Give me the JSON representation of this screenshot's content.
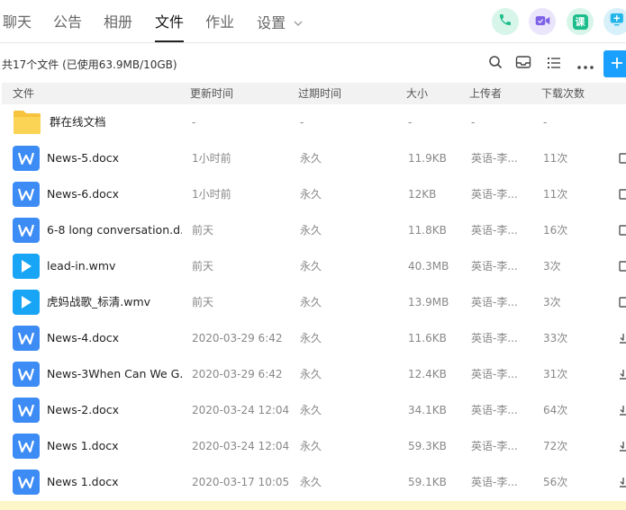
{
  "nav": {
    "tabs": [
      {
        "label": "聊天",
        "active": false
      },
      {
        "label": "公告",
        "active": false
      },
      {
        "label": "相册",
        "active": false
      },
      {
        "label": "文件",
        "active": true
      },
      {
        "label": "作业",
        "active": false
      },
      {
        "label": "设置",
        "active": false
      }
    ],
    "quick_actions": [
      {
        "icon": "phone-icon",
        "color": "#1bbd8b",
        "bg": "#d8f5ea"
      },
      {
        "icon": "video-camera-icon",
        "color": "#7e62e6",
        "bg": "#ebe5fb"
      },
      {
        "icon": "class-icon",
        "label": "课",
        "color": "#1bbd8b",
        "bg": "#d8f5ea"
      },
      {
        "icon": "share-screen-icon",
        "color": "#22b6e8",
        "bg": "#d7f0fa"
      }
    ]
  },
  "summary": {
    "text": "共17个文件 (已使用63.9MB/10GB)"
  },
  "toolbar": {
    "icons": [
      "search-icon",
      "inbox-icon",
      "list-view-icon",
      "more-icon",
      "plus-icon"
    ]
  },
  "table": {
    "columns": [
      "文件",
      "更新时间",
      "过期时间",
      "大小",
      "上传者",
      "下载次数"
    ],
    "rows": [
      {
        "type": "folder",
        "name": "群在线文档",
        "updated": "-",
        "expires": "-",
        "size": "-",
        "uploader": "-",
        "downloads": "-"
      },
      {
        "type": "word",
        "name": "News-5.docx",
        "updated": "1小时前",
        "expires": "永久",
        "size": "11.9KB",
        "uploader": "英语-李...",
        "downloads": "11次"
      },
      {
        "type": "word",
        "name": "News-6.docx",
        "updated": "1小时前",
        "expires": "永久",
        "size": "12KB",
        "uploader": "英语-李...",
        "downloads": "11次"
      },
      {
        "type": "word",
        "name": "6-8 long conversation.d...",
        "updated": "前天",
        "expires": "永久",
        "size": "11.8KB",
        "uploader": "英语-李...",
        "downloads": "16次"
      },
      {
        "type": "video",
        "name": "lead-in.wmv",
        "updated": "前天",
        "expires": "永久",
        "size": "40.3MB",
        "uploader": "英语-李...",
        "downloads": "3次"
      },
      {
        "type": "video",
        "name": "虎妈战歌_标清.wmv",
        "updated": "前天",
        "expires": "永久",
        "size": "13.9MB",
        "uploader": "英语-李...",
        "downloads": "3次"
      },
      {
        "type": "word",
        "name": "News-4.docx",
        "updated": "2020-03-29 6:42",
        "expires": "永久",
        "size": "11.6KB",
        "uploader": "英语-李...",
        "downloads": "33次"
      },
      {
        "type": "word",
        "name": "News-3When Can We G...",
        "updated": "2020-03-29 6:42",
        "expires": "永久",
        "size": "12.4KB",
        "uploader": "英语-李...",
        "downloads": "31次"
      },
      {
        "type": "word",
        "name": "News-2.docx",
        "updated": "2020-03-24 12:04",
        "expires": "永久",
        "size": "34.1KB",
        "uploader": "英语-李...",
        "downloads": "64次"
      },
      {
        "type": "word",
        "name": "News 1.docx",
        "updated": "2020-03-24 12:04",
        "expires": "永久",
        "size": "59.3KB",
        "uploader": "英语-李...",
        "downloads": "72次"
      },
      {
        "type": "word",
        "name": "News 1.docx",
        "updated": "2020-03-17 10:05",
        "expires": "永久",
        "size": "59.1KB",
        "uploader": "英语-李...",
        "downloads": "56次"
      }
    ]
  }
}
